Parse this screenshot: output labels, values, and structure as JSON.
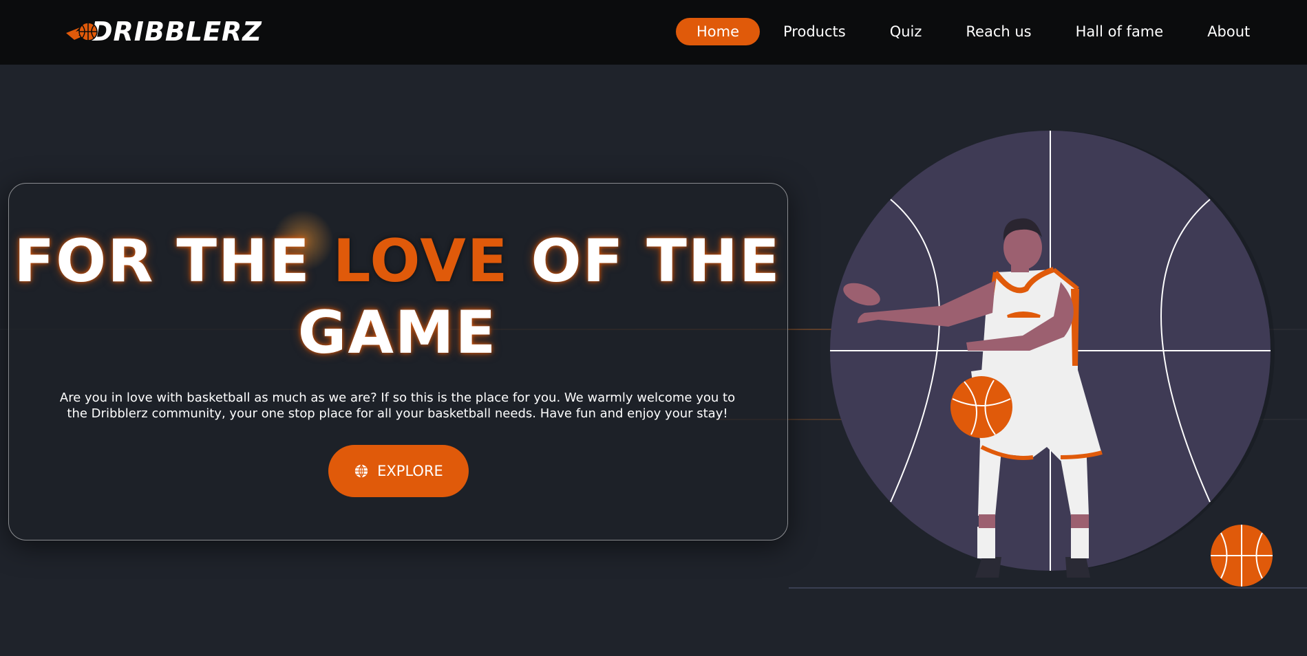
{
  "brand": {
    "name": "DRIBBLERZ",
    "logo_icon": "flaming-basketball-icon",
    "accent_color": "#e05a0a"
  },
  "nav": {
    "items": [
      {
        "label": "Home",
        "active": true
      },
      {
        "label": "Products",
        "active": false
      },
      {
        "label": "Quiz",
        "active": false
      },
      {
        "label": "Reach us",
        "active": false
      },
      {
        "label": "Hall of fame",
        "active": false
      },
      {
        "label": "About",
        "active": false
      }
    ]
  },
  "hero": {
    "headline_part1": "FOR THE ",
    "headline_accent": "LOVE",
    "headline_part2": " OF THE GAME",
    "tagline": "Are you in love with basketball as much as we are? If so this is the place for you. We warmly welcome you to the Dribblerz community, your one stop place for all your basketball needs. Have fun and enjoy your stay!",
    "cta_label": "EXPLORE",
    "cta_icon": "globe-icon"
  },
  "illustration": {
    "subject": "basketball-player-illustration"
  }
}
